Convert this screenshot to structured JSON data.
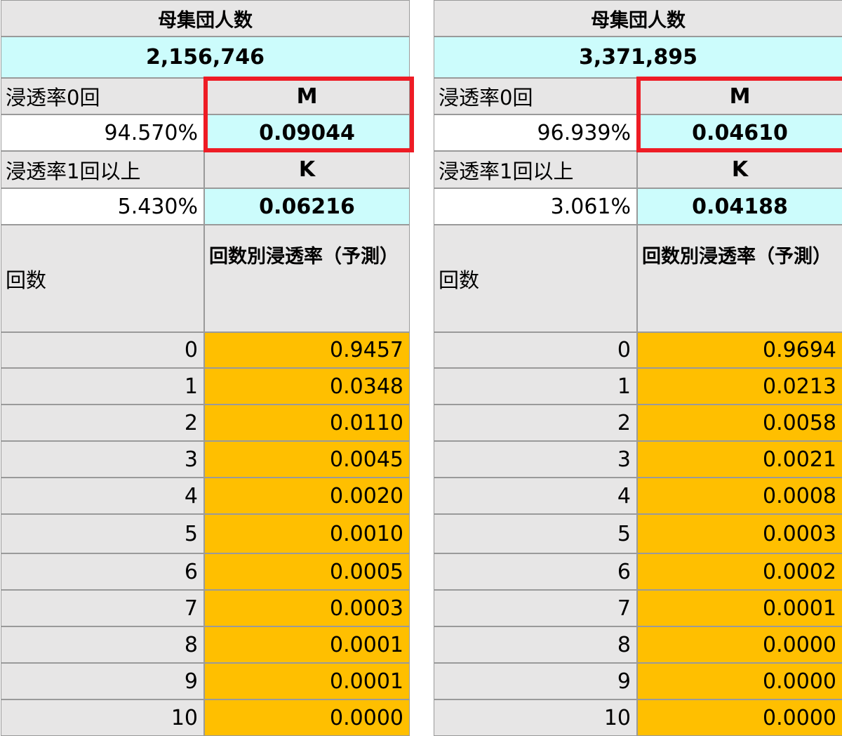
{
  "colors": {
    "header_gray": "#e7e6e6",
    "value_cyan": "#ccfcfc",
    "rate_orange": "#ffbf00",
    "highlight_red": "#ee1c25"
  },
  "panels": [
    {
      "population_label": "母集団人数",
      "population_value": "2,156,746",
      "penetration_zero_label": "浸透率0回",
      "m_label": "M",
      "penetration_zero_value": "94.570%",
      "m_value": "0.09044",
      "penetration_one_plus_label": "浸透率1回以上",
      "k_label": "K",
      "penetration_one_plus_value": "5.430%",
      "k_value": "0.06216",
      "count_header": "回数",
      "rate_header": "回数別浸透率（予測）",
      "rows": [
        {
          "count": "0",
          "rate": "0.9457"
        },
        {
          "count": "1",
          "rate": "0.0348"
        },
        {
          "count": "2",
          "rate": "0.0110"
        },
        {
          "count": "3",
          "rate": "0.0045"
        },
        {
          "count": "4",
          "rate": "0.0020"
        },
        {
          "count": "5",
          "rate": "0.0010"
        },
        {
          "count": "6",
          "rate": "0.0005"
        },
        {
          "count": "7",
          "rate": "0.0003"
        },
        {
          "count": "8",
          "rate": "0.0001"
        },
        {
          "count": "9",
          "rate": "0.0001"
        },
        {
          "count": "10",
          "rate": "0.0000"
        }
      ]
    },
    {
      "population_label": "母集団人数",
      "population_value": "3,371,895",
      "penetration_zero_label": "浸透率0回",
      "m_label": "M",
      "penetration_zero_value": "96.939%",
      "m_value": "0.04610",
      "penetration_one_plus_label": "浸透率1回以上",
      "k_label": "K",
      "penetration_one_plus_value": "3.061%",
      "k_value": "0.04188",
      "count_header": "回数",
      "rate_header": "回数別浸透率（予測）",
      "rows": [
        {
          "count": "0",
          "rate": "0.9694"
        },
        {
          "count": "1",
          "rate": "0.0213"
        },
        {
          "count": "2",
          "rate": "0.0058"
        },
        {
          "count": "3",
          "rate": "0.0021"
        },
        {
          "count": "4",
          "rate": "0.0008"
        },
        {
          "count": "5",
          "rate": "0.0003"
        },
        {
          "count": "6",
          "rate": "0.0002"
        },
        {
          "count": "7",
          "rate": "0.0001"
        },
        {
          "count": "8",
          "rate": "0.0000"
        },
        {
          "count": "9",
          "rate": "0.0000"
        },
        {
          "count": "10",
          "rate": "0.0000"
        }
      ]
    }
  ]
}
